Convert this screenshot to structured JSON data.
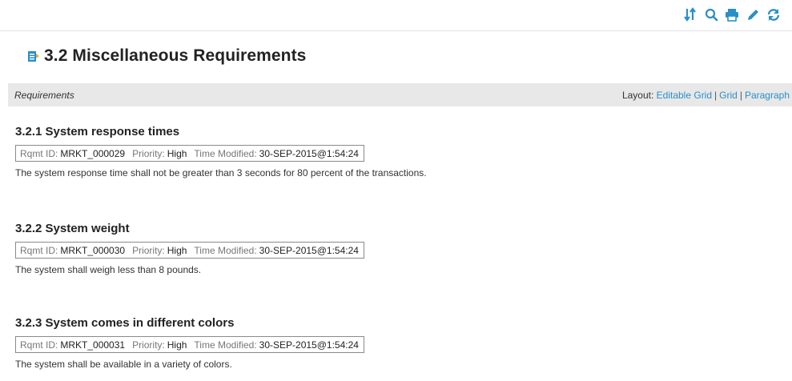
{
  "toolbar": {
    "icons": [
      "sort-icon",
      "search-icon",
      "print-icon",
      "edit-icon",
      "refresh-icon"
    ],
    "accent_color": "#2a8fc7"
  },
  "page": {
    "title": "3.2 Miscellaneous Requirements"
  },
  "section_bar": {
    "label": "Requirements",
    "layout_prefix": "Layout:",
    "layout_options": [
      "Editable Grid",
      "Grid",
      "Paragraph"
    ],
    "separator": "|"
  },
  "meta_labels": {
    "id": "Rqmt ID:",
    "priority": "Priority:",
    "modified": "Time Modified:"
  },
  "requirements": [
    {
      "heading": "3.2.1 System response times",
      "id": "MRKT_000029",
      "priority": "High",
      "modified": "30-SEP-2015@1:54:24",
      "description": "The system response time shall not be greater than 3 seconds for 80 percent of the transactions."
    },
    {
      "heading": "3.2.2 System weight",
      "id": "MRKT_000030",
      "priority": "High",
      "modified": "30-SEP-2015@1:54:24",
      "description": "The system shall weigh less than 8 pounds."
    },
    {
      "heading": "3.2.3 System comes in different colors",
      "id": "MRKT_000031",
      "priority": "High",
      "modified": "30-SEP-2015@1:54:24",
      "description": "The system shall be available in a variety of colors."
    }
  ]
}
